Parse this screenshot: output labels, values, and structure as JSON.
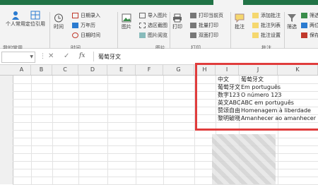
{
  "ribbon": {
    "buttons": {
      "personal_app": "个人常用",
      "locate_ref": "定位引用",
      "time": "时间",
      "picture": "图片",
      "print": "打印",
      "comment": "批注",
      "filter": "筛选"
    },
    "small_items": {
      "date_insert": "日期录入",
      "perpetual_calendar": "万年历",
      "date_calc": "日期时间",
      "insert_picture": "导入图片",
      "selected_screenshot": "选区截图",
      "picture_insert": "图片阅览",
      "print_current_page": "打印当前页",
      "batch_print": "批量打印",
      "duplex_print": "双面打印",
      "add_comment": "添加批注",
      "comment_list": "批注列表",
      "comment_settings": "批注设置",
      "filter_b": "筛选",
      "filter_c": "两位",
      "filter_d": "保存"
    },
    "groups": {
      "my_common": "我的常用",
      "time": "时间",
      "picture": "图片",
      "print": "打印",
      "comment": "批注"
    }
  },
  "formula_bar": {
    "fx": "fx",
    "content": "葡萄牙文"
  },
  "grid": {
    "columns": [
      "A",
      "B",
      "C",
      "D",
      "E",
      "F",
      "G",
      "H",
      "I",
      "J",
      "K"
    ],
    "cells": [
      {
        "col": "I",
        "row": 1,
        "text": "中文"
      },
      {
        "col": "J",
        "row": 1,
        "text": "葡萄牙文"
      },
      {
        "col": "I",
        "row": 2,
        "text": "葡萄牙文"
      },
      {
        "col": "J",
        "row": 2,
        "text": "Em português"
      },
      {
        "col": "I",
        "row": 3,
        "text": "数字123"
      },
      {
        "col": "J",
        "row": 3,
        "text": "O número 123"
      },
      {
        "col": "I",
        "row": 4,
        "text": "英文ABC"
      },
      {
        "col": "J",
        "row": 4,
        "text": "ABC em português"
      },
      {
        "col": "I",
        "row": 5,
        "text": "赞颂自由"
      },
      {
        "col": "J",
        "row": 5,
        "text": "Homenagem à liberdade"
      },
      {
        "col": "I",
        "row": 6,
        "text": "黎明破晓"
      },
      {
        "col": "J",
        "row": 6,
        "text": "Amanhecer ao amanhecer"
      }
    ]
  },
  "colors": {
    "accent": "#217346",
    "highlight": "#e03c3c"
  }
}
